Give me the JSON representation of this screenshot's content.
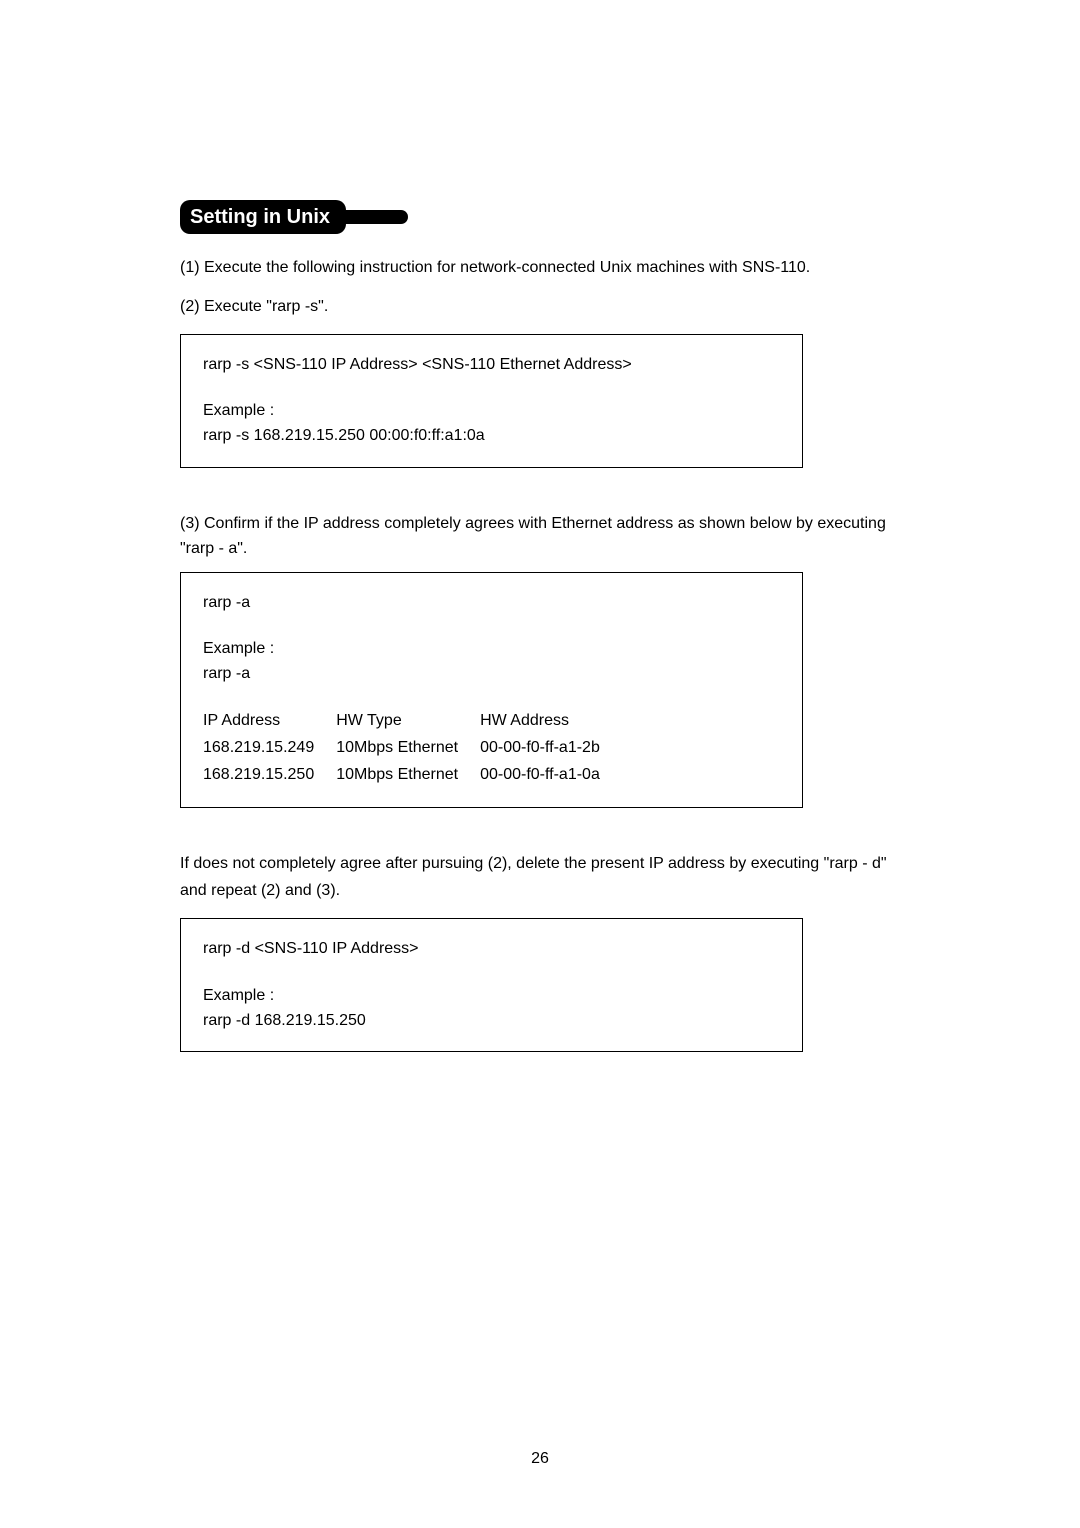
{
  "heading": "Setting in Unix",
  "instructions": {
    "step1": "(1)  Execute the following instruction for network-connected Unix machines with SNS-110.",
    "step2": "(2)  Execute \"rarp -s\".",
    "step3": "(3)  Confirm if the IP address completely agrees with Ethernet address as shown below by executing \"rarp - a\".",
    "note_line1": "If does not completely agree after pursuing (2), delete the present IP address by executing \"rarp - d\"",
    "note_line2": "and repeat (2) and (3)."
  },
  "box1": {
    "l1": "rarp -s <SNS-110 IP Address> <SNS-110 Ethernet Address>",
    "l2": "Example :",
    "l3": "rarp -s 168.219.15.250 00:00:f0:ff:a1:0a"
  },
  "box2": {
    "l1": "rarp -a",
    "l2": "Example :",
    "l3": "rarp -a",
    "table_header": {
      "c1": "IP Address",
      "c2": "HW Type",
      "c3": "HW Address"
    },
    "rows": [
      {
        "c1": "168.219.15.249",
        "c2": "10Mbps Ethernet",
        "c3": "00-00-f0-ff-a1-2b"
      },
      {
        "c1": "168.219.15.250",
        "c2": "10Mbps Ethernet",
        "c3": "00-00-f0-ff-a1-0a"
      }
    ]
  },
  "box3": {
    "l1": "rarp -d <SNS-110 IP Address>",
    "l2": "Example :",
    "l3": "rarp -d 168.219.15.250"
  },
  "page_number": "26"
}
